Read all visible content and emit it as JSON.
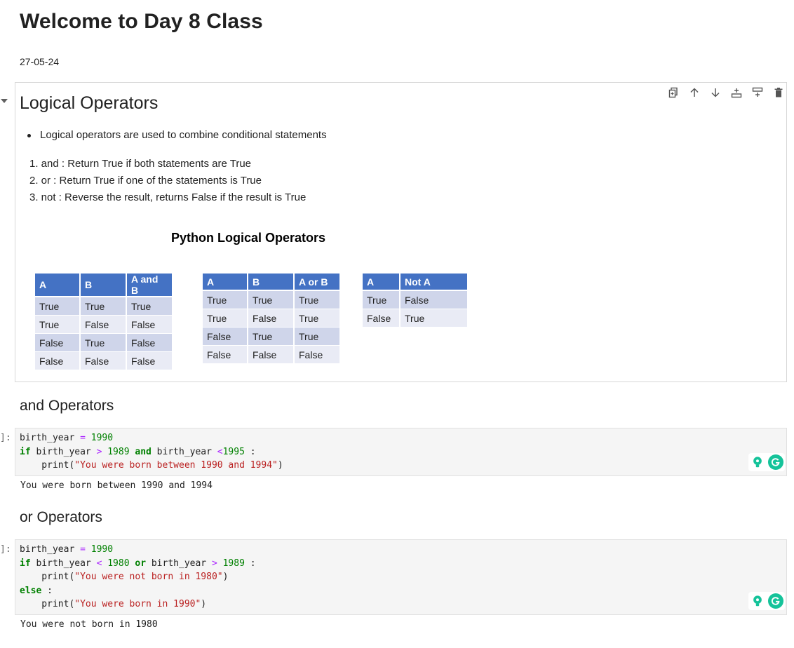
{
  "title": "Welcome to Day 8 Class",
  "date": "27-05-24",
  "logical_section": {
    "heading": "Logical Operators",
    "bullet": "Logical operators are used to combine conditional statements",
    "list": [
      "1. and : Return True if both statements are True",
      "2. or : Return True if one of the statements is True",
      "3. not : Reverse the result, returns False if the result is True"
    ],
    "image_title": "Python Logical Operators",
    "and_table": {
      "headers": [
        "A",
        "B",
        "A and B"
      ],
      "rows": [
        [
          "True",
          "True",
          "True"
        ],
        [
          "True",
          "False",
          "False"
        ],
        [
          "False",
          "True",
          "False"
        ],
        [
          "False",
          "False",
          "False"
        ]
      ]
    },
    "or_table": {
      "headers": [
        "A",
        "B",
        "A or B"
      ],
      "rows": [
        [
          "True",
          "True",
          "True"
        ],
        [
          "True",
          "False",
          "True"
        ],
        [
          "False",
          "True",
          "True"
        ],
        [
          "False",
          "False",
          "False"
        ]
      ]
    },
    "not_table": {
      "headers": [
        "A",
        "Not A"
      ],
      "rows": [
        [
          "True",
          "False"
        ],
        [
          "False",
          "True"
        ]
      ]
    }
  },
  "and_section": {
    "heading": "and Operators",
    "prompt": "]:",
    "output": "You were born between 1990 and 1994"
  },
  "or_section": {
    "heading": "or Operators",
    "prompt": "]:",
    "output": "You were not born in 1980"
  },
  "colors": {
    "table_header": "#4472c4",
    "table_row_odd": "#cfd5ea",
    "table_row_even": "#e9ebf5",
    "grammarly": "#15c39a"
  },
  "toolbar_icons": [
    "duplicate-icon",
    "move-up-icon",
    "move-down-icon",
    "insert-above-icon",
    "insert-below-icon",
    "delete-icon"
  ]
}
